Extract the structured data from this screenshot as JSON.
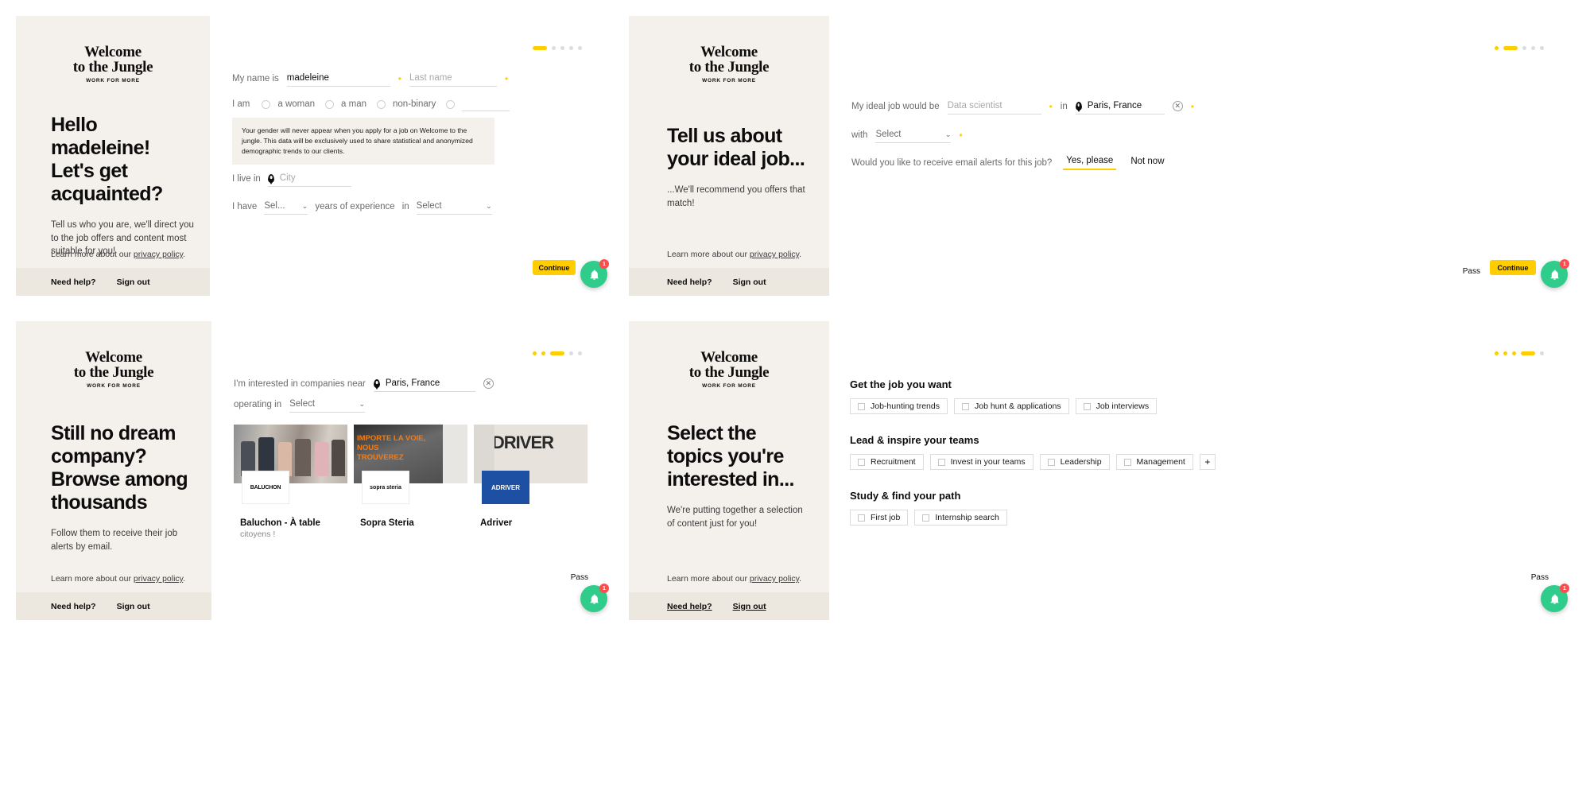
{
  "brand": {
    "logo_line1": "Welcome",
    "logo_line2": "to the Jungle",
    "logo_tagline": "WORK FOR MORE",
    "accent": "#ffcd00",
    "hero_bg": "#f4f1ec",
    "fab_color": "#2fcc8b",
    "badge_color": "#ff4d4d"
  },
  "common": {
    "privacy_prefix": "Learn more about our ",
    "privacy_link": "privacy policy",
    "privacy_suffix": ".",
    "need_help": "Need help?",
    "sign_out": "Sign out",
    "continue_label": "Continue",
    "pass_label": "Pass",
    "bell_icon": "bell-icon",
    "badge_count": "1"
  },
  "panel1": {
    "hero_title": "Hello madeleine! Let's get acquainted?",
    "hero_sub": "Tell us who you are, we'll direct you to the job offers and content most suitable for you!",
    "progress": {
      "total": 5,
      "active_index": 0
    },
    "form": {
      "name_label": "My name is",
      "first_name_value": "madeleine",
      "last_name_placeholder": "Last name",
      "gender_label": "I am",
      "gender_options": [
        "a woman",
        "a man",
        "non-binary"
      ],
      "gender_custom_placeholder": "",
      "gender_notice": "Your gender will never appear when you apply for a job on Welcome to the jungle. This data will be exclusively used to share statistical and anonymized demographic trends to our clients.",
      "city_label": "I live in",
      "city_placeholder": "City",
      "city_icon": "location-pin-icon",
      "experience_label": "I have",
      "experience_select": "Sel...",
      "experience_mid": "years of experience",
      "experience_in": "in",
      "field_select": "Select"
    }
  },
  "panel2": {
    "hero_title": "Tell us about your ideal job...",
    "hero_sub": "...We'll recommend you offers that match!",
    "progress": {
      "total": 5,
      "active_index": 1
    },
    "form": {
      "job_label": "My ideal job would be",
      "job_placeholder": "Data scientist",
      "in_label": "in",
      "location_value": "Paris, France",
      "location_icon": "location-pin-icon",
      "clear_icon": "clear-circle-icon",
      "with_label": "with",
      "contract_select": "Select",
      "alerts_question": "Would you like to receive email alerts for this job?",
      "alerts_yes": "Yes, please",
      "alerts_no": "Not now"
    }
  },
  "panel3": {
    "hero_title": "Still no dream company? Browse among thousands",
    "hero_sub": "Follow them to receive their job alerts by email.",
    "progress": {
      "total": 5,
      "active_index": 2
    },
    "form": {
      "near_label": "I'm interested in companies near",
      "location_value": "Paris, France",
      "location_icon": "location-pin-icon",
      "clear_icon": "clear-circle-icon",
      "operating_label": "operating in",
      "sector_select": "Select"
    },
    "cards": [
      {
        "name": "Baluchon - À table",
        "desc": "citoyens !",
        "logo_text": "BALUCHON",
        "img_kind": "team-photo"
      },
      {
        "name": "Sopra Steria",
        "desc": "",
        "logo_text": "sopra steria",
        "img_kind": "poster-orange",
        "poster_lines": [
          "IMPORTE LA VOIE,",
          "NOUS",
          "TROUVEREZ",
          "...",
          ""
        ]
      },
      {
        "name": "Adriver",
        "desc": "",
        "logo_text": "ADRIVER",
        "img_kind": "wordmark",
        "wordmark": "ADRIVER"
      }
    ]
  },
  "panel4": {
    "hero_title": "Select the topics you're interested in...",
    "hero_sub": "We're putting together a selection of content just for you!",
    "progress": {
      "total": 5,
      "active_index": 3
    },
    "groups": [
      {
        "title": "Get the job you want",
        "chips": [
          "Job-hunting trends",
          "Job hunt & applications",
          "Job interviews"
        ],
        "has_more": false
      },
      {
        "title": "Lead & inspire your teams",
        "chips": [
          "Recruitment",
          "Invest in your teams",
          "Leadership",
          "Management"
        ],
        "has_more": true,
        "more_label": "+"
      },
      {
        "title": "Study & find your path",
        "chips": [
          "First job",
          "Internship search"
        ],
        "has_more": false
      }
    ]
  }
}
